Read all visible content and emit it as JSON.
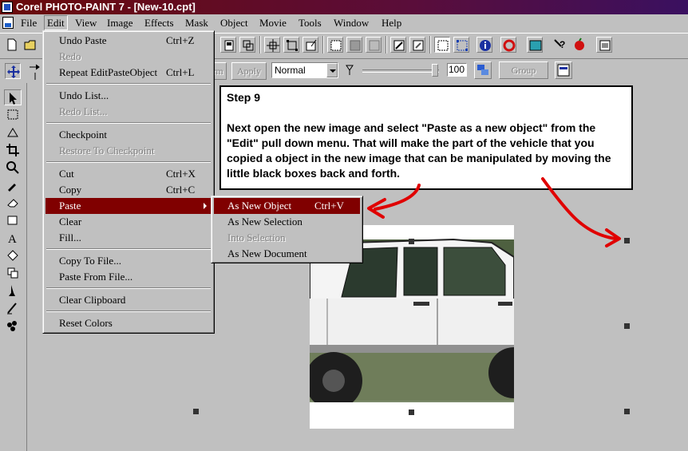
{
  "window": {
    "title": "Corel PHOTO-PAINT 7 - [New-10.cpt]"
  },
  "menubar": {
    "items": [
      "File",
      "Edit",
      "View",
      "Image",
      "Effects",
      "Mask",
      "Object",
      "Movie",
      "Tools",
      "Window",
      "Help"
    ]
  },
  "optionbar": {
    "partial_button_label": "rm",
    "apply_label": "Apply",
    "merge_mode": "Normal",
    "opacity_value": "100",
    "group_label": "Group"
  },
  "edit_menu": {
    "undo_paste": {
      "label": "Undo Paste",
      "shortcut": "Ctrl+Z"
    },
    "redo": {
      "label": "Redo"
    },
    "repeat": {
      "label": "Repeat EditPasteObject",
      "shortcut": "Ctrl+L"
    },
    "undo_list": {
      "label": "Undo List..."
    },
    "redo_list": {
      "label": "Redo List..."
    },
    "checkpoint": {
      "label": "Checkpoint"
    },
    "restore_checkpoint": {
      "label": "Restore To Checkpoint"
    },
    "cut": {
      "label": "Cut",
      "shortcut": "Ctrl+X"
    },
    "copy": {
      "label": "Copy",
      "shortcut": "Ctrl+C"
    },
    "paste": {
      "label": "Paste"
    },
    "clear": {
      "label": "Clear"
    },
    "fill": {
      "label": "Fill..."
    },
    "copy_to_file": {
      "label": "Copy To File..."
    },
    "paste_from_file": {
      "label": "Paste From File..."
    },
    "clear_clipboard": {
      "label": "Clear Clipboard"
    },
    "reset_colors": {
      "label": "Reset Colors"
    }
  },
  "paste_submenu": {
    "as_new_object": {
      "label": "As New Object",
      "shortcut": "Ctrl+V"
    },
    "as_new_selection": {
      "label": "As New Selection"
    },
    "into_selection": {
      "label": "Into Selection"
    },
    "as_new_document": {
      "label": "As New Document"
    }
  },
  "tutorial": {
    "step_title": "Step 9",
    "step_text": "Next open  the  new image and select \"Paste as a new object\" from the \"Edit\" pull down menu. That will make the part of the vehicle that you copied a object in the new image that can be manipulated by moving the little black boxes back and forth."
  },
  "colors": {
    "title_bar_start": "#6a0a0a",
    "title_bar_end": "#3a1060",
    "menu_highlight": "#800000",
    "annotation_arrow": "#e00000",
    "face": "#c0c0c0"
  }
}
